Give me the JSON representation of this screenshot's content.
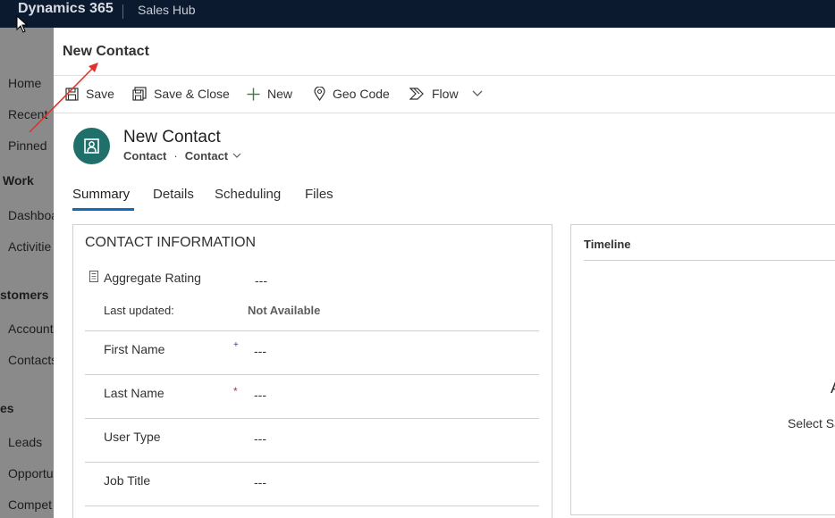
{
  "topbar": {
    "brand": "Dynamics 365",
    "app_name": "Sales Hub"
  },
  "sitemap": {
    "items": [
      {
        "label": "Home",
        "type": "item"
      },
      {
        "label": "Recent",
        "type": "item"
      },
      {
        "label": "Pinned",
        "type": "item"
      },
      {
        "label": "Work",
        "type": "group"
      },
      {
        "label": "Dashboa",
        "type": "item"
      },
      {
        "label": "Activitie",
        "type": "item"
      },
      {
        "label": "stomers",
        "type": "group"
      },
      {
        "label": "Account",
        "type": "item"
      },
      {
        "label": "Contacts",
        "type": "item"
      },
      {
        "label": "es",
        "type": "group"
      },
      {
        "label": "Leads",
        "type": "item"
      },
      {
        "label": "Opportu",
        "type": "item"
      },
      {
        "label": "Compet",
        "type": "item"
      }
    ]
  },
  "dialog": {
    "title": "New Contact",
    "commands": {
      "save": "Save",
      "save_close": "Save & Close",
      "new": "New",
      "geo_code": "Geo Code",
      "flow": "Flow"
    },
    "record": {
      "title": "New Contact",
      "entity": "Contact",
      "form": "Contact"
    },
    "tabs": [
      "Summary",
      "Details",
      "Scheduling",
      "Files"
    ],
    "section": {
      "title": "CONTACT INFORMATION",
      "aggregate_label": "Aggregate Rating",
      "aggregate_value": "---",
      "last_updated_label": "Last updated:",
      "last_updated_value": "Not Available",
      "fields": [
        {
          "label": "First Name",
          "value": "---",
          "marker": "+"
        },
        {
          "label": "Last Name",
          "value": "---",
          "marker": "*"
        },
        {
          "label": "User Type",
          "value": "---",
          "marker": ""
        },
        {
          "label": "Job Title",
          "value": "---",
          "marker": ""
        }
      ]
    },
    "timeline": {
      "title": "Timeline",
      "partial_heading": "A",
      "partial_text": "Select Sa"
    }
  },
  "colors": {
    "topbar": "#0b1a2e",
    "accent": "#0f6cbd",
    "avatar": "#1f6f6b",
    "required": "#c4262e",
    "annotation_arrow": "#e0322a"
  }
}
